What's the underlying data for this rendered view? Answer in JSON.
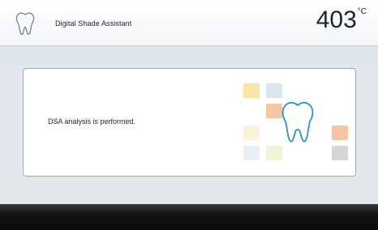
{
  "header": {
    "title": "Digital Shade Assistant",
    "temperature_value": "403",
    "temperature_unit": "°C",
    "icon": "tooth-icon"
  },
  "panel": {
    "message": "DSA analysis is performed.",
    "illustration": "tooth-shade-illustration-icon",
    "shade_colors": [
      "#f9e6a6",
      "#dce6ee",
      "#f3c89f",
      "#fbf1d8",
      "#e6eef3",
      "#f1f3d6",
      "#f7c4a4",
      "#d6d6d6"
    ]
  },
  "colors": {
    "tooth_outline": "#2b8fd0",
    "card_border": "#98aac0",
    "background": "#e4e8ed",
    "footer": "#121212"
  }
}
